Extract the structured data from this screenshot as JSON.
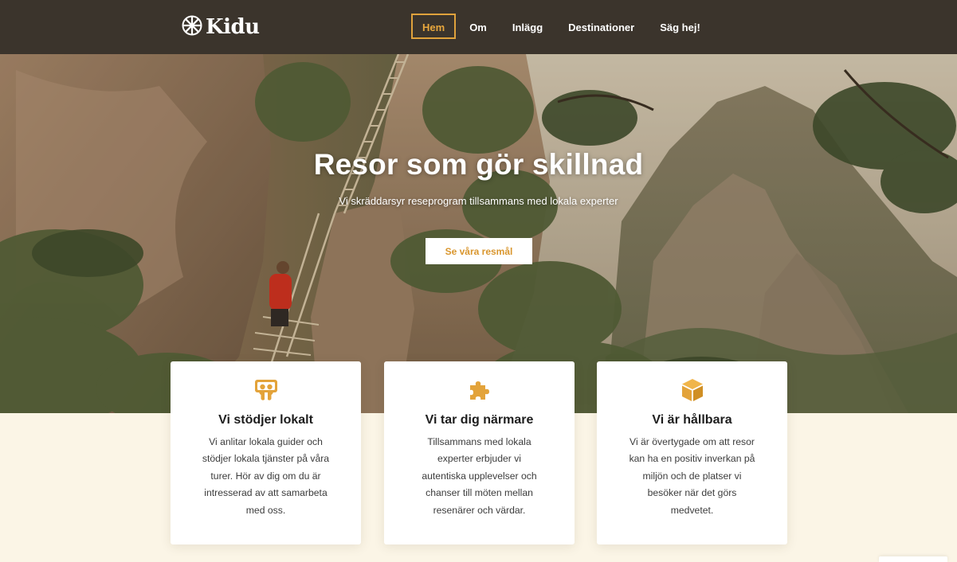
{
  "brand": {
    "name": "Kidu",
    "logo_icon": "wheel-icon"
  },
  "nav": {
    "items": [
      {
        "label": "Hem",
        "active": true
      },
      {
        "label": "Om"
      },
      {
        "label": "Inlägg"
      },
      {
        "label": "Destinationer"
      },
      {
        "label": "Säg hej!"
      }
    ]
  },
  "hero": {
    "title": "Resor som gör skillnad",
    "subtitle": "Vi skräddarsyr reseprogram tillsammans med lokala experter",
    "cta_label": "Se våra resmål"
  },
  "features": [
    {
      "icon": "slideshare-icon",
      "title": "Vi stödjer lokalt",
      "text": "Vi anlitar lokala guider och stödjer lokala tjänster på våra turer. Hör av dig om du är intresserad av att samarbeta med oss."
    },
    {
      "icon": "puzzle-piece-icon",
      "title": "Vi tar dig närmare",
      "text": "Tillsammans med lokala experter erbjuder vi autentiska upplevelser och chanser till möten mellan resenärer och värdar."
    },
    {
      "icon": "cube-icon",
      "title": "Vi är hållbara",
      "text": "Vi är övertygade om att resor kan ha en positiv inverkan på miljön och de platser vi besöker när det görs medvetet."
    }
  ],
  "colors": {
    "header_bg": "#3b342c",
    "accent": "#e0a23c",
    "page_bg": "#fbf5e6",
    "card_bg": "#ffffff"
  }
}
